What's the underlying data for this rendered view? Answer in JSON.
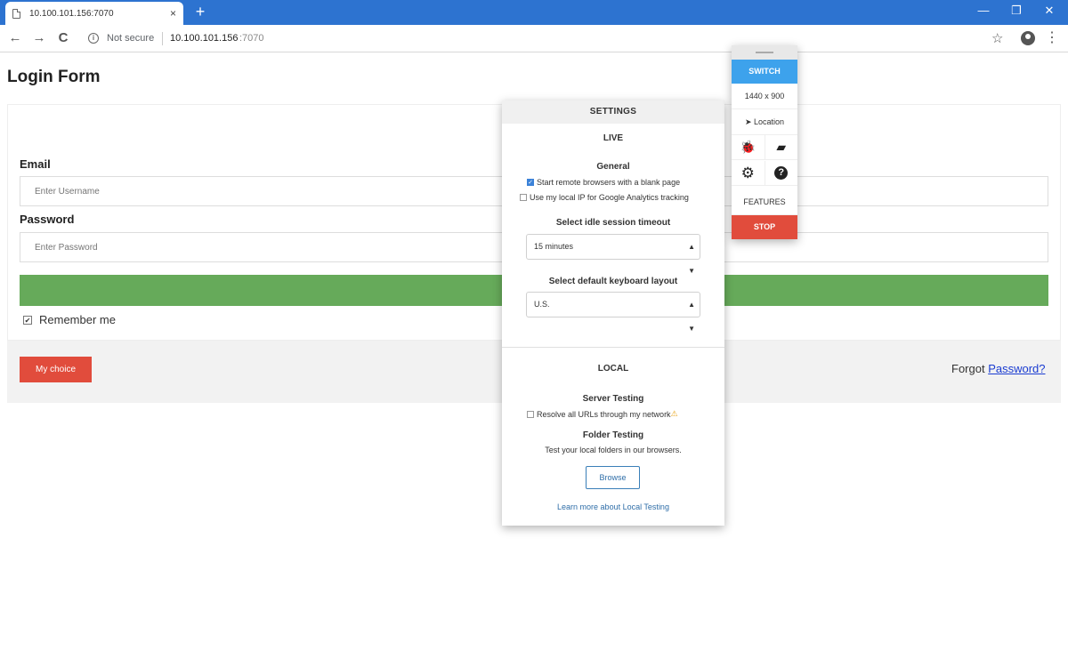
{
  "browser": {
    "tab_title": "10.100.101.156:7070",
    "tab_close": "×",
    "new_tab": "+",
    "win_min": "—",
    "win_max": "❐",
    "win_close": "✕",
    "back": "←",
    "forward": "→",
    "reload": "C",
    "security_label": "Not secure",
    "url_host": "10.100.101.156",
    "url_port": ":7070",
    "star": "☆",
    "menu": "⋮"
  },
  "page": {
    "title": "Login Form",
    "email_label": "Email",
    "email_placeholder": "Enter Username",
    "password_label": "Password",
    "password_placeholder": "Enter Password",
    "remember_label": "Remember me",
    "choice_button": "My choice",
    "forgot_prefix": "Forgot ",
    "forgot_link": "Password?",
    "colors": {
      "login_bar": "#66aa5a",
      "choice_button": "#e14c3c",
      "link": "#1a3cd1"
    }
  },
  "settings": {
    "header": "SETTINGS",
    "live_title": "LIVE",
    "general_title": "General",
    "opt_blank_page": "Start remote browsers with a blank page",
    "opt_blank_page_checked": true,
    "opt_local_ip": "Use my local IP for Google Analytics tracking",
    "opt_local_ip_checked": false,
    "idle_timeout_label": "Select idle session timeout",
    "idle_timeout_value": "15 minutes",
    "keyboard_label": "Select default keyboard layout",
    "keyboard_value": "U.S.",
    "local_title": "LOCAL",
    "server_testing_title": "Server Testing",
    "resolve_urls": "Resolve all URLs through my network",
    "resolve_urls_checked": false,
    "folder_testing_title": "Folder Testing",
    "folder_testing_desc": "Test your local folders in our browsers.",
    "browse_button": "Browse",
    "learn_more_link": "Learn more about Local Testing"
  },
  "toolbar": {
    "switch_label": "SWITCH",
    "resolution": "1440 x 900",
    "location_label": "Location",
    "features_label": "FEATURES",
    "stop_label": "STOP",
    "colors": {
      "switch": "#3da2ec",
      "stop": "#e14c3c"
    }
  }
}
